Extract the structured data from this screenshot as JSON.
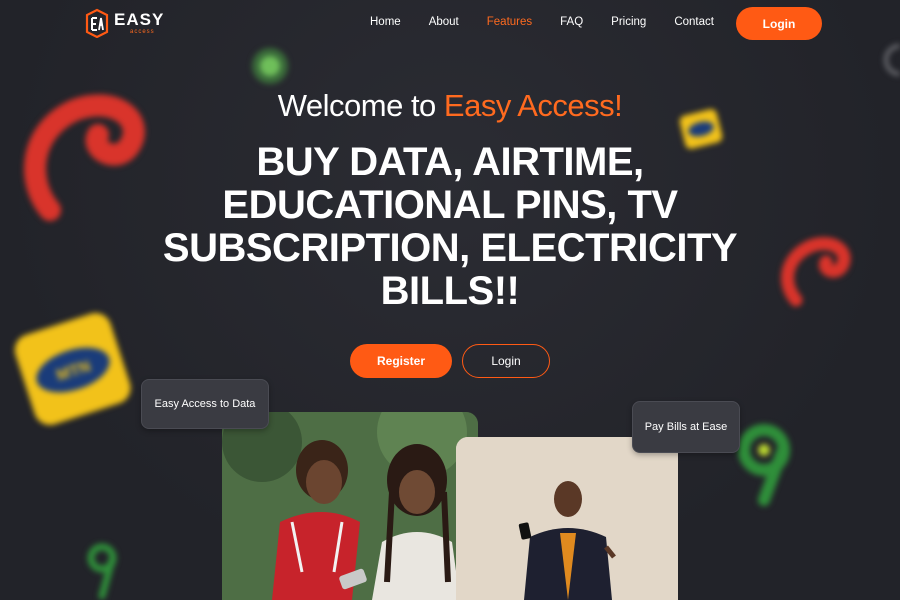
{
  "header": {
    "logo_name": "EASY",
    "logo_sub": "access",
    "nav": [
      {
        "label": "Home"
      },
      {
        "label": "About"
      },
      {
        "label": "Features",
        "active": true
      },
      {
        "label": "FAQ"
      },
      {
        "label": "Pricing"
      },
      {
        "label": "Contact"
      }
    ],
    "login_label": "Login"
  },
  "hero": {
    "welcome_prefix": "Welcome to ",
    "welcome_brand": "Easy Access!",
    "headline": "BUY DATA, AIRTIME, EDUCATIONAL PINS, TV SUBSCRIPTION, ELECTRICITY BILLS!!",
    "register_label": "Register",
    "login_label": "Login"
  },
  "cards": {
    "tag_left": "Easy Access to Data",
    "tag_right": "Pay Bills at Ease"
  },
  "decor": {
    "mtn_text": "MTN",
    "accent": "#ff5a14",
    "background": "#24252b"
  }
}
